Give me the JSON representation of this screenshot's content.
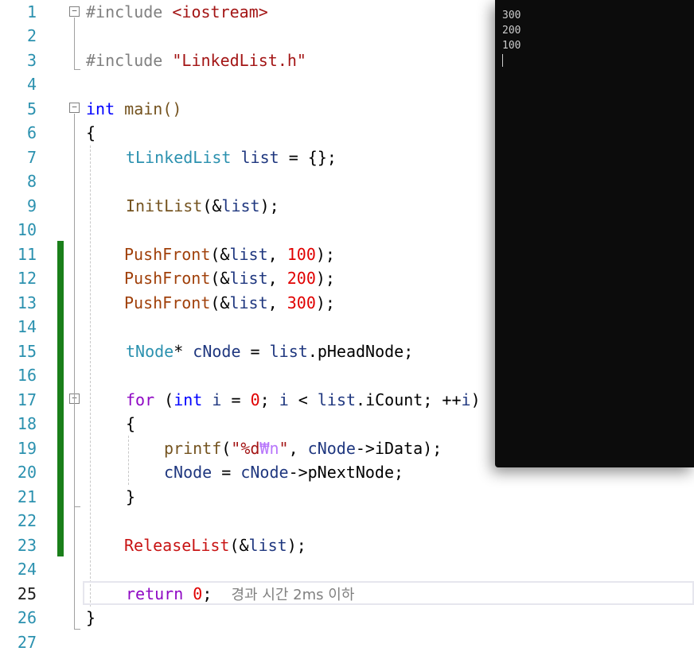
{
  "editor": {
    "line_numbers": [
      "1",
      "2",
      "3",
      "4",
      "5",
      "6",
      "7",
      "8",
      "9",
      "10",
      "11",
      "12",
      "13",
      "14",
      "15",
      "16",
      "17",
      "18",
      "19",
      "20",
      "21",
      "22",
      "23",
      "24",
      "25",
      "26",
      "27"
    ],
    "active_line": "25",
    "code": {
      "l1_directive": "#include",
      "l1_header": "<iostream>",
      "l3_directive": "#include",
      "l3_header": "\"LinkedList.h\"",
      "l5_int": "int",
      "l5_main": " main()",
      "l6_brace": "{",
      "l7_type": "tLinkedList",
      "l7_var": " list",
      "l7_rest": " = {};",
      "l9_fn": "InitList",
      "l9_open": "(&",
      "l9_var": "list",
      "l9_close": ");",
      "push_fn": "PushFront",
      "push_open": "(&",
      "push_var": "list",
      "push_comma": ", ",
      "push_close": ");",
      "push_values": [
        "100",
        "200",
        "300"
      ],
      "l15_type": "tNode",
      "l15_star": "*",
      "l15_var": " cNode",
      "l15_eq": " = ",
      "l15_list": "list",
      "l15_member": ".pHeadNode;",
      "l17_for": "for",
      "l17_open": " (",
      "l17_int": "int",
      "l17_i": " i",
      "l17_eq": " = ",
      "l17_zero": "0",
      "l17_semi": ";",
      "l17_i2": " i",
      "l17_lt": " < ",
      "l17_list": "list",
      "l17_member": ".iCount",
      "l17_semi2": "; ++",
      "l17_i3": "i",
      "l17_close": ")",
      "l18_brace": "{",
      "l19_fn": "printf",
      "l19_open": "(",
      "l19_str1": "\"%d",
      "l19_esc": "₩n",
      "l19_str2": "\"",
      "l19_comma": ", ",
      "l19_var": "cNode",
      "l19_member": "->iData);",
      "l20_var": "cNode",
      "l20_eq": " = ",
      "l20_var2": "cNode",
      "l20_member": "->pNextNode;",
      "l21_brace": "}",
      "l23_fn": "ReleaseList",
      "l23_open": "(&",
      "l23_var": "list",
      "l23_close": ");",
      "l25_return": "return",
      "l25_zero": " 0",
      "l25_semi": ";",
      "l25_hint": "경과 시간 2ms 이하",
      "l26_brace": "}"
    }
  },
  "console": {
    "output_lines": [
      "300",
      "200",
      "100"
    ]
  },
  "colors": {
    "keyword": "#0000ff",
    "type": "#2b91af",
    "string": "#a31515",
    "number": "#e00000",
    "change_bar": "#1a7f1a",
    "console_bg": "#0c0c0c"
  }
}
